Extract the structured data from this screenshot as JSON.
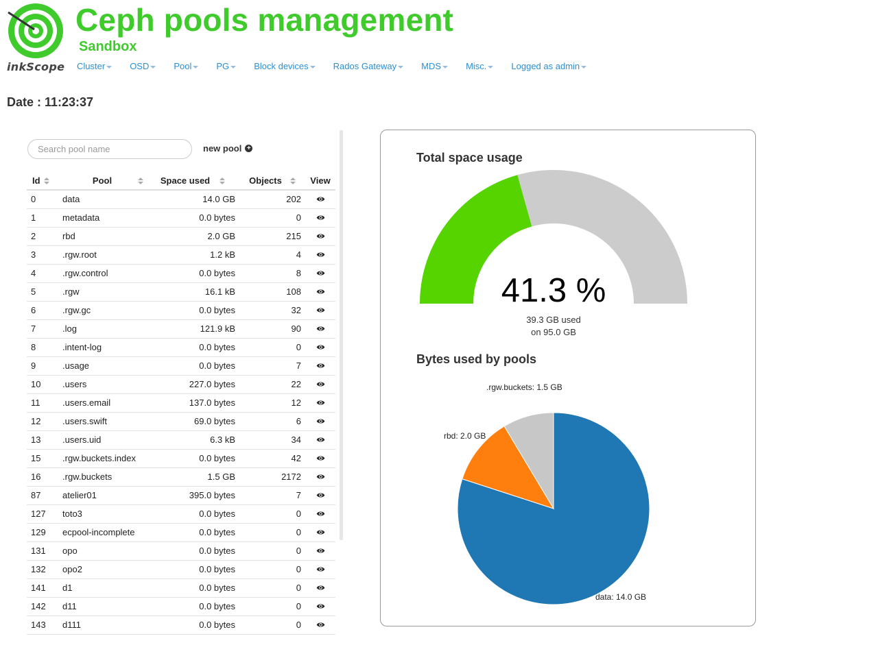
{
  "brand": {
    "logo_text": "inkScope",
    "title": "Ceph pools management",
    "subtitle": "Sandbox",
    "accent": "#3ecb2b"
  },
  "nav": {
    "items": [
      {
        "label": "Cluster",
        "icon": "caret-down-icon"
      },
      {
        "label": "OSD",
        "icon": "caret-down-icon"
      },
      {
        "label": "Pool",
        "icon": "caret-down-icon"
      },
      {
        "label": "PG",
        "icon": "caret-down-icon"
      },
      {
        "label": "Block devices",
        "icon": "caret-down-icon"
      },
      {
        "label": "Rados Gateway",
        "icon": "caret-down-icon"
      },
      {
        "label": "MDS",
        "icon": "caret-down-icon"
      },
      {
        "label": "Misc.",
        "icon": "caret-down-icon"
      },
      {
        "label": "Logged as admin",
        "icon": "caret-down-icon"
      }
    ],
    "link_color": "#2a8fd6"
  },
  "date_label": "Date : 11:23:37",
  "pool_list": {
    "search_placeholder": "Search pool name",
    "new_pool_label": "new pool",
    "columns": [
      "Id",
      "Pool",
      "Space used",
      "Objects",
      "View"
    ],
    "rows": [
      {
        "id": "0",
        "name": "data",
        "space": "14.0 GB",
        "objects": "202"
      },
      {
        "id": "1",
        "name": "metadata",
        "space": "0.0 bytes",
        "objects": "0"
      },
      {
        "id": "2",
        "name": "rbd",
        "space": "2.0 GB",
        "objects": "215"
      },
      {
        "id": "3",
        "name": ".rgw.root",
        "space": "1.2 kB",
        "objects": "4"
      },
      {
        "id": "4",
        "name": ".rgw.control",
        "space": "0.0 bytes",
        "objects": "8"
      },
      {
        "id": "5",
        "name": ".rgw",
        "space": "16.1 kB",
        "objects": "108"
      },
      {
        "id": "6",
        "name": ".rgw.gc",
        "space": "0.0 bytes",
        "objects": "32"
      },
      {
        "id": "7",
        "name": ".log",
        "space": "121.9 kB",
        "objects": "90"
      },
      {
        "id": "8",
        "name": ".intent-log",
        "space": "0.0 bytes",
        "objects": "0"
      },
      {
        "id": "9",
        "name": ".usage",
        "space": "0.0 bytes",
        "objects": "7"
      },
      {
        "id": "10",
        "name": ".users",
        "space": "227.0 bytes",
        "objects": "22"
      },
      {
        "id": "11",
        "name": ".users.email",
        "space": "137.0 bytes",
        "objects": "12"
      },
      {
        "id": "12",
        "name": ".users.swift",
        "space": "69.0 bytes",
        "objects": "6"
      },
      {
        "id": "13",
        "name": ".users.uid",
        "space": "6.3 kB",
        "objects": "34"
      },
      {
        "id": "15",
        "name": ".rgw.buckets.index",
        "space": "0.0 bytes",
        "objects": "42"
      },
      {
        "id": "16",
        "name": ".rgw.buckets",
        "space": "1.5 GB",
        "objects": "2172"
      },
      {
        "id": "87",
        "name": "atelier01",
        "space": "395.0 bytes",
        "objects": "7"
      },
      {
        "id": "127",
        "name": "toto3",
        "space": "0.0 bytes",
        "objects": "0"
      },
      {
        "id": "129",
        "name": "ecpool-incomplete",
        "space": "0.0 bytes",
        "objects": "0"
      },
      {
        "id": "131",
        "name": "opo",
        "space": "0.0 bytes",
        "objects": "0"
      },
      {
        "id": "132",
        "name": "opo2",
        "space": "0.0 bytes",
        "objects": "0"
      },
      {
        "id": "141",
        "name": "d1",
        "space": "0.0 bytes",
        "objects": "0"
      },
      {
        "id": "142",
        "name": "d11",
        "space": "0.0 bytes",
        "objects": "0"
      },
      {
        "id": "143",
        "name": "d111",
        "space": "0.0 bytes",
        "objects": "0"
      }
    ]
  },
  "total_usage": {
    "title": "Total space usage",
    "percent_label": "41.3 %",
    "used_label": "39.3 GB used",
    "total_label": "on 95.0 GB",
    "used_fraction": 0.413,
    "used_color": "#55d400",
    "free_color": "#cccccc"
  },
  "pools_pie": {
    "title": "Bytes used by pools"
  },
  "chart_data": [
    {
      "type": "gauge",
      "title": "Total space usage",
      "value": 41.3,
      "used": 39.3,
      "total": 95.0,
      "unit": "GB",
      "range": [
        0,
        100
      ]
    },
    {
      "type": "pie",
      "title": "Bytes used by pools",
      "labels": [
        "data: 14.0 GB",
        "rbd: 2.0 GB",
        ".rgw.buckets: 1.5 GB"
      ],
      "categories": [
        "data",
        "rbd",
        ".rgw.buckets"
      ],
      "values": [
        14.0,
        2.0,
        1.5
      ],
      "colors": [
        "#1f77b4",
        "#ff7f0e",
        "#c7c7c7"
      ]
    }
  ]
}
